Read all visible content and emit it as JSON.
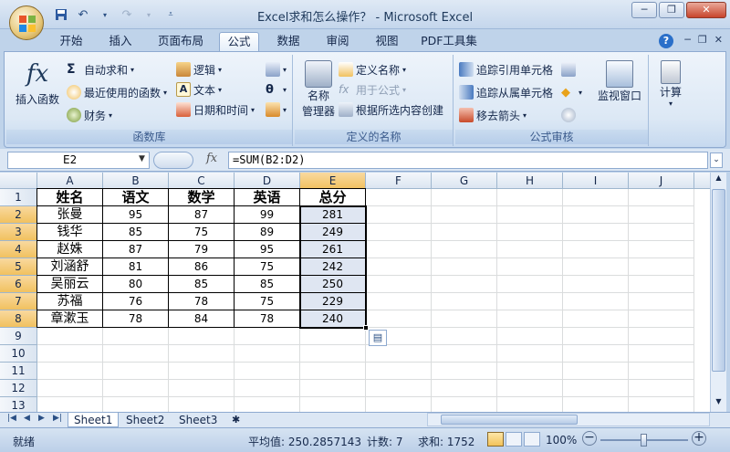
{
  "window": {
    "title": "Excel求和怎么操作？ - Microsoft Excel"
  },
  "tabs": [
    "开始",
    "插入",
    "页面布局",
    "公式",
    "数据",
    "审阅",
    "视图",
    "PDF工具集"
  ],
  "active_tab": "公式",
  "ribbon": {
    "library": {
      "label": "函数库",
      "insert_function": "插入函数",
      "autosum": "自动求和",
      "recent": "最近使用的函数",
      "financial": "财务",
      "logical": "逻辑",
      "text": "文本",
      "datetime": "日期和时间"
    },
    "names": {
      "label": "定义的名称",
      "name_manager_1": "名称",
      "name_manager_2": "管理器",
      "define_name": "定义名称",
      "use_in_formula": "用于公式",
      "create_from_selection": "根据所选内容创建"
    },
    "audit": {
      "label": "公式审核",
      "trace_precedents": "追踪引用单元格",
      "trace_dependents": "追踪从属单元格",
      "remove_arrows": "移去箭头",
      "watch_window": "监视窗口"
    },
    "calc": {
      "label": "计算"
    }
  },
  "formula_bar": {
    "name_box": "E2",
    "fx": "fx",
    "formula": "=SUM(B2:D2)"
  },
  "columns": [
    "A",
    "B",
    "C",
    "D",
    "E",
    "F",
    "G",
    "H",
    "I",
    "J"
  ],
  "rows": [
    "1",
    "2",
    "3",
    "4",
    "5",
    "6",
    "7",
    "8",
    "9",
    "10",
    "11",
    "12",
    "13"
  ],
  "table": {
    "headers": [
      "姓名",
      "语文",
      "数学",
      "英语",
      "总分"
    ],
    "rows": [
      [
        "张曼",
        "95",
        "87",
        "99",
        "281"
      ],
      [
        "钱华",
        "85",
        "75",
        "89",
        "249"
      ],
      [
        "赵姝",
        "87",
        "79",
        "95",
        "261"
      ],
      [
        "刘涵舒",
        "81",
        "86",
        "75",
        "242"
      ],
      [
        "吴丽云",
        "80",
        "85",
        "85",
        "250"
      ],
      [
        "苏福",
        "76",
        "78",
        "75",
        "229"
      ],
      [
        "章漱玉",
        "78",
        "84",
        "78",
        "240"
      ]
    ]
  },
  "sheets": [
    "Sheet1",
    "Sheet2",
    "Sheet3"
  ],
  "status": {
    "ready": "就绪",
    "average": "平均值: 250.2857143",
    "count": "计数: 7",
    "sum": "求和: 1752",
    "zoom": "100%"
  }
}
